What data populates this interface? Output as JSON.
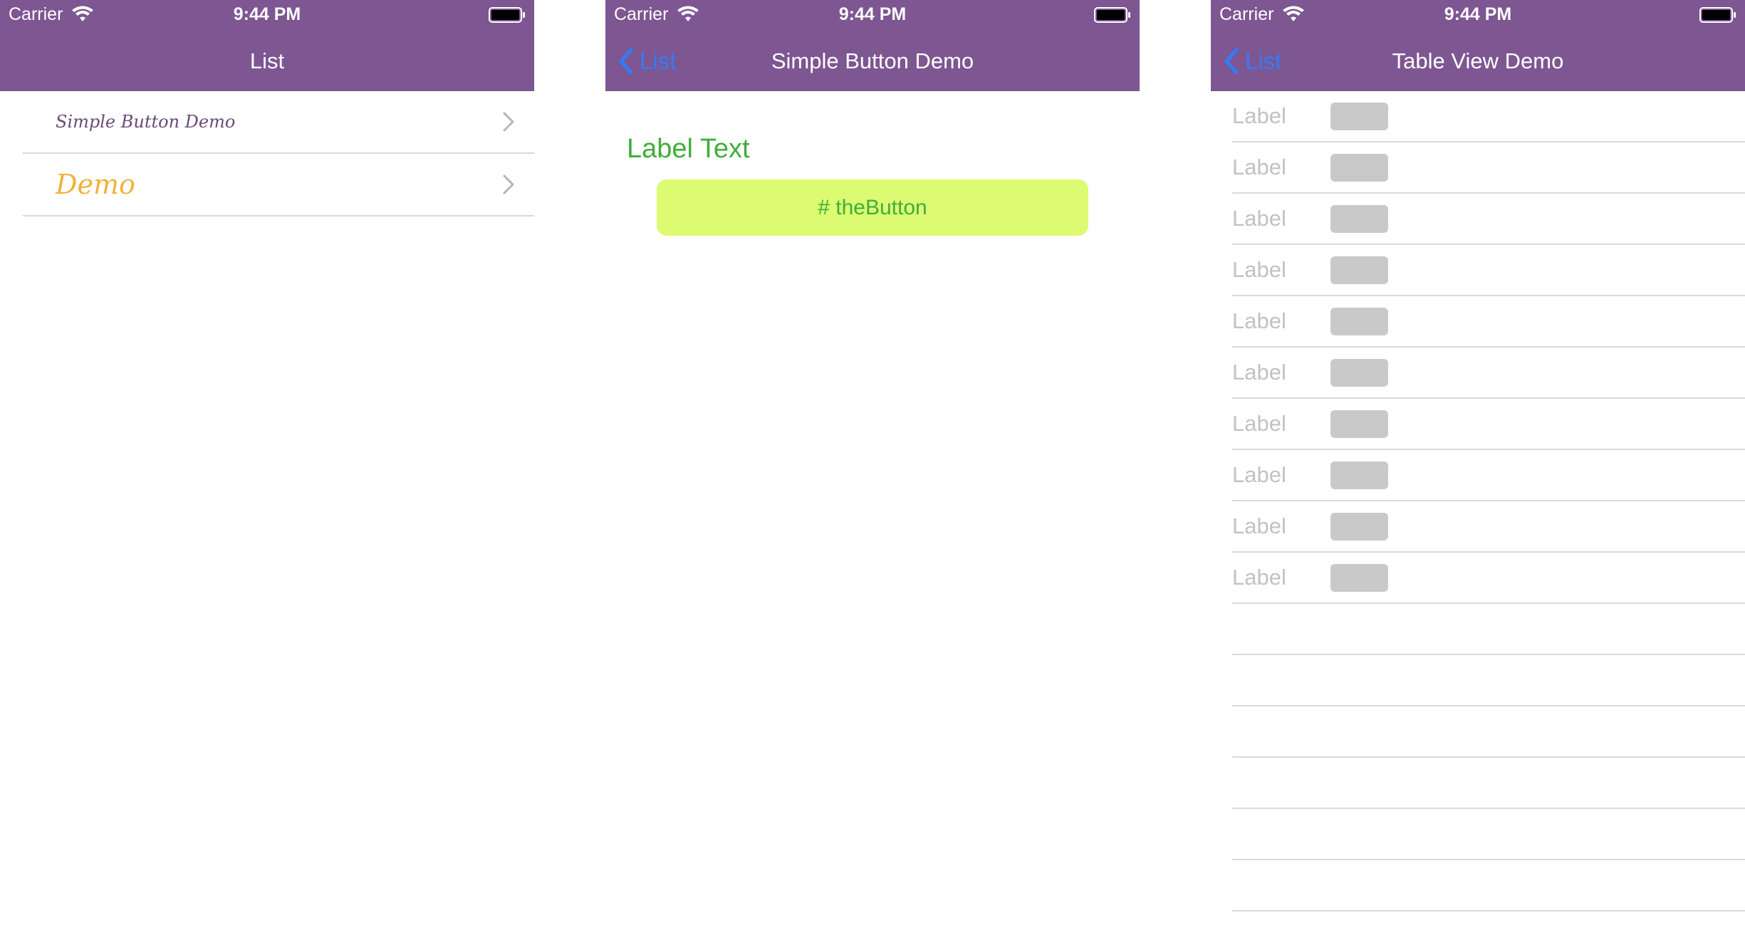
{
  "colors": {
    "navbar": "#7d5692",
    "back_link": "#2f7dfa",
    "label_green": "#3fae3a",
    "button_bg": "#dcfb72",
    "row1_text": "#6a4a78",
    "row2_text": "#f0b23b",
    "cell_label": "#c2c2c2",
    "cell_box": "#c9c9c9",
    "separator": "#d9d9d9"
  },
  "status_bar": {
    "carrier": "Carrier",
    "time": "9:44 PM",
    "icons": [
      "wifi-icon",
      "battery-icon"
    ]
  },
  "screen1": {
    "nav_title": "List",
    "rows": [
      {
        "label": "Simple Button Demo",
        "icon": "chevron-right-icon"
      },
      {
        "label": "Demo",
        "icon": "chevron-right-icon"
      }
    ]
  },
  "screen2": {
    "back_label": "List",
    "nav_title": "Simple Button Demo",
    "label_text": "Label Text",
    "button_label": "# theButton"
  },
  "screen3": {
    "back_label": "List",
    "nav_title": "Table View Demo",
    "rows": [
      {
        "label": "Label"
      },
      {
        "label": "Label"
      },
      {
        "label": "Label"
      },
      {
        "label": "Label"
      },
      {
        "label": "Label"
      },
      {
        "label": "Label"
      },
      {
        "label": "Label"
      },
      {
        "label": "Label"
      },
      {
        "label": "Label"
      },
      {
        "label": "Label"
      }
    ]
  }
}
